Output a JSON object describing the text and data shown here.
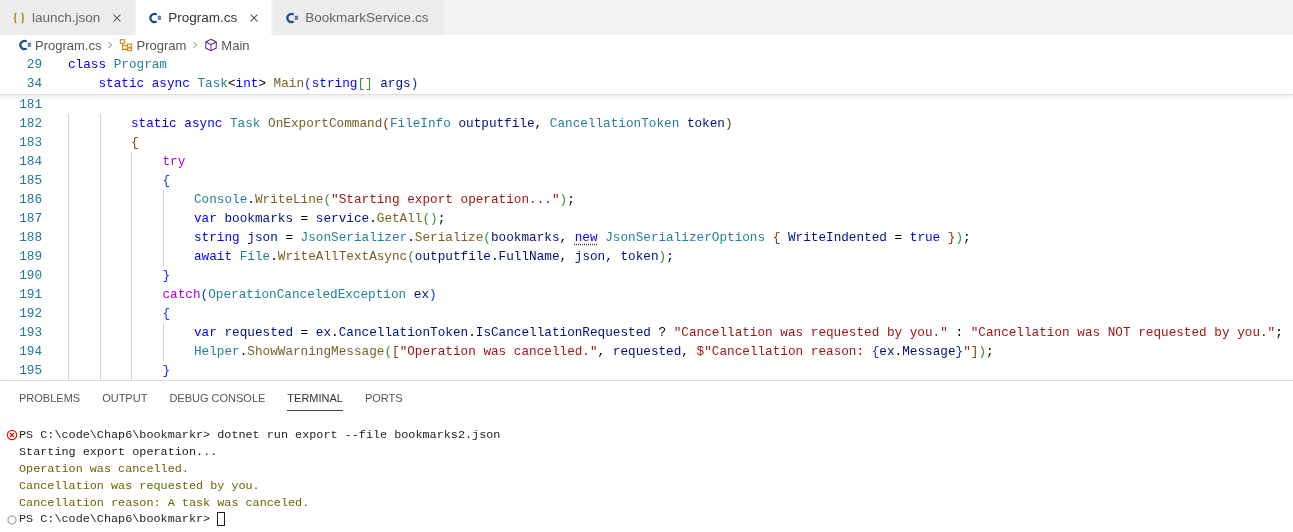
{
  "tabs": [
    {
      "label": "launch.json",
      "kind": "json",
      "selected": false,
      "close_visible": true
    },
    {
      "label": "Program.cs",
      "kind": "csharp",
      "selected": true,
      "close_visible": true
    },
    {
      "label": "BookmarkService.cs",
      "kind": "csharp",
      "selected": false,
      "close_visible": false
    }
  ],
  "breadcrumbs": [
    {
      "label": "Program.cs",
      "kind": "csharp"
    },
    {
      "label": "Program",
      "kind": "class"
    },
    {
      "label": "Main",
      "kind": "method"
    }
  ],
  "sticky_lines": [
    {
      "number": "29",
      "tokens": [
        {
          "t": "class ",
          "kind": "kw"
        },
        {
          "t": "Program",
          "kind": "type"
        }
      ]
    },
    {
      "number": "34",
      "tokens": [
        {
          "t": "    static async ",
          "kind": "kw"
        },
        {
          "t": "Task",
          "kind": "type"
        },
        {
          "t": "<",
          "kind": "p"
        },
        {
          "t": "int",
          "kind": "kw"
        },
        {
          "t": "> ",
          "kind": "p"
        },
        {
          "t": "Main",
          "kind": "fn"
        },
        {
          "t": "(",
          "kind": "b1"
        },
        {
          "t": "string",
          "kind": "kw"
        },
        {
          "t": "[] ",
          "kind": "b2"
        },
        {
          "t": "args",
          "kind": "var"
        },
        {
          "t": ")",
          "kind": "b1"
        }
      ]
    }
  ],
  "code_lines": [
    {
      "number": "181"
    },
    {
      "number": "182",
      "tokens": [
        {
          "t": "        static async ",
          "kind": "kw"
        },
        {
          "t": "Task ",
          "kind": "type"
        },
        {
          "t": "OnExportCommand",
          "kind": "fn"
        },
        {
          "t": "(",
          "kind": "b3"
        },
        {
          "t": "FileInfo ",
          "kind": "type"
        },
        {
          "t": "outputfile",
          "kind": "var"
        },
        {
          "t": ", ",
          "kind": "p"
        },
        {
          "t": "CancellationToken ",
          "kind": "type"
        },
        {
          "t": "token",
          "kind": "var"
        },
        {
          "t": ")",
          "kind": "b3"
        }
      ]
    },
    {
      "number": "183",
      "tokens": [
        {
          "t": "        {",
          "kind": "b3"
        }
      ]
    },
    {
      "number": "184",
      "tokens": [
        {
          "t": "            try",
          "kind": "ctl"
        }
      ]
    },
    {
      "number": "185",
      "tokens": [
        {
          "t": "            {",
          "kind": "b1"
        }
      ]
    },
    {
      "number": "186",
      "tokens": [
        {
          "t": "                Console",
          "kind": "type"
        },
        {
          "t": ".",
          "kind": "p"
        },
        {
          "t": "WriteLine",
          "kind": "fn"
        },
        {
          "t": "(",
          "kind": "b2"
        },
        {
          "t": "\"Starting export operation...\"",
          "kind": "str"
        },
        {
          "t": ")",
          "kind": "b2"
        },
        {
          "t": ";",
          "kind": "p"
        }
      ]
    },
    {
      "number": "187",
      "tokens": [
        {
          "t": "                var ",
          "kind": "kw"
        },
        {
          "t": "bookmarks",
          "kind": "var"
        },
        {
          "t": " = ",
          "kind": "p"
        },
        {
          "t": "service",
          "kind": "var"
        },
        {
          "t": ".",
          "kind": "p"
        },
        {
          "t": "GetAll",
          "kind": "fn"
        },
        {
          "t": "()",
          "kind": "b2"
        },
        {
          "t": ";",
          "kind": "p"
        }
      ]
    },
    {
      "number": "188",
      "tokens": [
        {
          "t": "                string ",
          "kind": "kw"
        },
        {
          "t": "json",
          "kind": "var"
        },
        {
          "t": " = ",
          "kind": "p"
        },
        {
          "t": "JsonSerializer",
          "kind": "type"
        },
        {
          "t": ".",
          "kind": "p"
        },
        {
          "t": "Serialize",
          "kind": "fn"
        },
        {
          "t": "(",
          "kind": "b2"
        },
        {
          "t": "bookmarks",
          "kind": "var"
        },
        {
          "t": ", ",
          "kind": "p"
        },
        {
          "t": "new",
          "kind": "kw",
          "hint": true
        },
        {
          "t": " JsonSerializerOptions ",
          "kind": "type"
        },
        {
          "t": "{ ",
          "kind": "b3"
        },
        {
          "t": "WriteIndented",
          "kind": "var"
        },
        {
          "t": " = ",
          "kind": "p"
        },
        {
          "t": "true ",
          "kind": "kw"
        },
        {
          "t": "}",
          "kind": "b3"
        },
        {
          "t": ")",
          "kind": "b2"
        },
        {
          "t": ";",
          "kind": "p"
        }
      ]
    },
    {
      "number": "189",
      "tokens": [
        {
          "t": "                await ",
          "kind": "kw"
        },
        {
          "t": "File",
          "kind": "type"
        },
        {
          "t": ".",
          "kind": "p"
        },
        {
          "t": "WriteAllTextAsync",
          "kind": "fn"
        },
        {
          "t": "(",
          "kind": "b2"
        },
        {
          "t": "outputfile",
          "kind": "var"
        },
        {
          "t": ".",
          "kind": "p"
        },
        {
          "t": "FullName",
          "kind": "var"
        },
        {
          "t": ", ",
          "kind": "p"
        },
        {
          "t": "json",
          "kind": "var"
        },
        {
          "t": ", ",
          "kind": "p"
        },
        {
          "t": "token",
          "kind": "var"
        },
        {
          "t": ")",
          "kind": "b2"
        },
        {
          "t": ";",
          "kind": "p"
        }
      ]
    },
    {
      "number": "190",
      "tokens": [
        {
          "t": "            }",
          "kind": "b1"
        }
      ]
    },
    {
      "number": "191",
      "tokens": [
        {
          "t": "            catch",
          "kind": "ctl"
        },
        {
          "t": "(",
          "kind": "b1"
        },
        {
          "t": "OperationCanceledException ",
          "kind": "type"
        },
        {
          "t": "ex",
          "kind": "var"
        },
        {
          "t": ")",
          "kind": "b1"
        }
      ]
    },
    {
      "number": "192",
      "tokens": [
        {
          "t": "            {",
          "kind": "b1"
        }
      ]
    },
    {
      "number": "193",
      "tokens": [
        {
          "t": "                var ",
          "kind": "kw"
        },
        {
          "t": "requested",
          "kind": "var"
        },
        {
          "t": " = ",
          "kind": "p"
        },
        {
          "t": "ex",
          "kind": "var"
        },
        {
          "t": ".",
          "kind": "p"
        },
        {
          "t": "CancellationToken",
          "kind": "var"
        },
        {
          "t": ".",
          "kind": "p"
        },
        {
          "t": "IsCancellationRequested",
          "kind": "var"
        },
        {
          "t": " ? ",
          "kind": "p"
        },
        {
          "t": "\"Cancellation was requested by you.\"",
          "kind": "str"
        },
        {
          "t": " : ",
          "kind": "p"
        },
        {
          "t": "\"Cancellation was NOT requested by you.\"",
          "kind": "str"
        },
        {
          "t": ";",
          "kind": "p"
        }
      ]
    },
    {
      "number": "194",
      "tokens": [
        {
          "t": "                Helper",
          "kind": "type"
        },
        {
          "t": ".",
          "kind": "p"
        },
        {
          "t": "ShowWarningMessage",
          "kind": "fn"
        },
        {
          "t": "(",
          "kind": "b2"
        },
        {
          "t": "[",
          "kind": "b3"
        },
        {
          "t": "\"Operation was cancelled.\"",
          "kind": "str"
        },
        {
          "t": ", ",
          "kind": "p"
        },
        {
          "t": "requested",
          "kind": "var"
        },
        {
          "t": ", ",
          "kind": "p"
        },
        {
          "t": "$\"Cancellation reason: ",
          "kind": "str"
        },
        {
          "t": "{",
          "kind": "b1"
        },
        {
          "t": "ex",
          "kind": "var"
        },
        {
          "t": ".",
          "kind": "p"
        },
        {
          "t": "Message",
          "kind": "var"
        },
        {
          "t": "}",
          "kind": "b1"
        },
        {
          "t": "\"",
          "kind": "str"
        },
        {
          "t": "]",
          "kind": "b3"
        },
        {
          "t": ")",
          "kind": "b2"
        },
        {
          "t": ";",
          "kind": "p"
        }
      ]
    },
    {
      "number": "195",
      "tokens": [
        {
          "t": "            }",
          "kind": "b1"
        }
      ]
    }
  ],
  "panel_tabs": [
    {
      "label": "PROBLEMS",
      "selected": false
    },
    {
      "label": "OUTPUT",
      "selected": false
    },
    {
      "label": "DEBUG CONSOLE",
      "selected": false
    },
    {
      "label": "TERMINAL",
      "selected": true
    },
    {
      "label": "PORTS",
      "selected": false
    }
  ],
  "terminal_lines": [
    {
      "kind": "prompt",
      "error": true,
      "text": "PS C:\\code\\Chap6\\bookmarkr> dotnet run export --file bookmarks2.json",
      "cursor": false
    },
    {
      "kind": "output",
      "text": "Starting export operation..."
    },
    {
      "kind": "warning",
      "text": "Operation was cancelled."
    },
    {
      "kind": "warning",
      "text": "Cancellation was requested by you."
    },
    {
      "kind": "warning",
      "text": "Cancellation reason: A task was canceled."
    },
    {
      "kind": "prompt",
      "error": false,
      "text": "PS C:\\code\\Chap6\\bookmarkr>",
      "cursor": true
    }
  ]
}
